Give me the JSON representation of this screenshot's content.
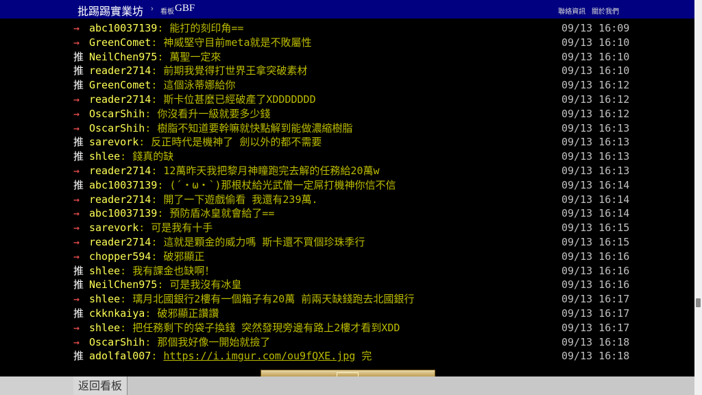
{
  "header": {
    "site_title": "批踢踢實業坊",
    "separator": "›",
    "board_label": "看板",
    "board_name": "GBF",
    "links": [
      "聯絡資訊",
      "關於我們"
    ]
  },
  "pushes": [
    {
      "tag": "→",
      "user": "abc10037139",
      "msg": ": 能打的刻印角==",
      "time": "09/13 16:09"
    },
    {
      "tag": "→",
      "user": "GreenComet",
      "msg": ": 神威堅守目前meta就是不敗屬性",
      "time": "09/13 16:10"
    },
    {
      "tag": "推",
      "user": "NeilChen975",
      "msg": ": 萬聖一定來",
      "time": "09/13 16:10"
    },
    {
      "tag": "推",
      "user": "reader2714",
      "msg": ": 前期我覺得打世界王拿突破素材",
      "time": "09/13 16:10"
    },
    {
      "tag": "推",
      "user": "GreenComet",
      "msg": ": 這個泳蒂娜給你",
      "time": "09/13 16:12"
    },
    {
      "tag": "→",
      "user": "reader2714",
      "msg": ": 斯卡位甚麼已經破產了XDDDDDDD",
      "time": "09/13 16:12"
    },
    {
      "tag": "→",
      "user": "OscarShih",
      "msg": ": 你沒看升一級就要多少錢",
      "time": "09/13 16:12"
    },
    {
      "tag": "→",
      "user": "OscarShih",
      "msg": ": 樹脂不知道要幹嘛就快點解到能做濃縮樹脂",
      "time": "09/13 16:13"
    },
    {
      "tag": "推",
      "user": "sarevork",
      "msg": ": 反正時代是機神了 劍以外的都不需要",
      "time": "09/13 16:13"
    },
    {
      "tag": "推",
      "user": "shlee",
      "msg": ": 錢真的缺",
      "time": "09/13 16:13"
    },
    {
      "tag": "→",
      "user": "reader2714",
      "msg": ": 12萬昨天我把黎月神瞳跑完去解的任務給20萬w",
      "time": "09/13 16:13"
    },
    {
      "tag": "推",
      "user": "abc10037139",
      "msg": ": (´・ω・`)那根杖給光武僧一定屌打機神你信不信",
      "time": "09/13 16:14"
    },
    {
      "tag": "→",
      "user": "reader2714",
      "msg": ": 開了一下遊戲偷看 我還有239萬.",
      "time": "09/13 16:14"
    },
    {
      "tag": "→",
      "user": "abc10037139",
      "msg": ": 預防盾冰皇就會給了==",
      "time": "09/13 16:14"
    },
    {
      "tag": "→",
      "user": "sarevork",
      "msg": ": 可是我有十手",
      "time": "09/13 16:15"
    },
    {
      "tag": "→",
      "user": "reader2714",
      "msg": ": 這就是顆金的威力嗎 斯卡還不買個珍珠季行",
      "time": "09/13 16:15"
    },
    {
      "tag": "→",
      "user": "chopper594",
      "msg": ": 破邪顯正",
      "time": "09/13 16:16"
    },
    {
      "tag": "推",
      "user": "shlee",
      "msg": ": 我有課金也缺啊！",
      "time": "09/13 16:16"
    },
    {
      "tag": "推",
      "user": "NeilChen975",
      "msg": ": 可是我沒有冰皇",
      "time": "09/13 16:16"
    },
    {
      "tag": "→",
      "user": "shlee",
      "msg": ": 璃月北國銀行2樓有一個箱子有20萬 前兩天缺錢跑去北國銀行",
      "time": "09/13 16:17"
    },
    {
      "tag": "推",
      "user": "ckknkaiya",
      "msg": ": 破邪顯正讚讚",
      "time": "09/13 16:17"
    },
    {
      "tag": "→",
      "user": "shlee",
      "msg": ": 把任務剩下的袋子換錢 突然發現旁邊有路上2樓才看到XDD",
      "time": "09/13 16:17"
    },
    {
      "tag": "→",
      "user": "OscarShih",
      "msg": ": 那個我好像一開始就撿了",
      "time": "09/13 16:18"
    },
    {
      "tag": "推",
      "user": "adolfal007",
      "msg": ": ",
      "link": "https://i.imgur.com/ou9fQXE.jpg",
      "suffix": " 完",
      "time": "09/13 16:18"
    }
  ],
  "footer": {
    "back_button": "返回看板"
  }
}
